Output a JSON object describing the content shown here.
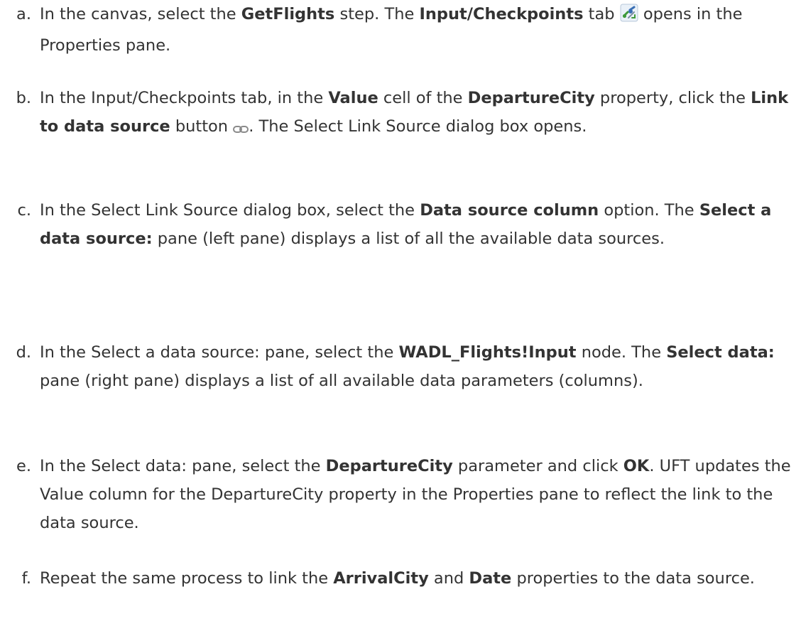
{
  "steps": [
    {
      "letter": "a.",
      "parts": [
        "In the canvas, select the ",
        "GetFlights",
        " step. The ",
        "Input/Checkpoints",
        " tab ",
        " opens in the Properties pane."
      ]
    },
    {
      "letter": "b.",
      "parts": [
        "In the Input/Checkpoints tab, in the ",
        "Value",
        " cell of the ",
        "DepartureCity",
        " property, click the ",
        "Link to data source",
        " button ",
        ". The Select Link Source dialog box opens."
      ]
    },
    {
      "letter": "c.",
      "parts": [
        "In the Select Link Source dialog box, select the ",
        "Data source column",
        " option. The ",
        "Select a data source:",
        " pane (left pane) displays a list of all the available data sources."
      ]
    },
    {
      "letter": "d.",
      "parts": [
        "In the Select a data source: pane, select the ",
        "WADL_Flights!Input",
        " node. The ",
        "Select data:",
        " pane (right pane) displays a list of all available data parameters (columns)."
      ]
    },
    {
      "letter": "e.",
      "parts": [
        "In the Select data: pane, select the ",
        "DepartureCity",
        " parameter and click ",
        "OK",
        ". UFT updates the Value column for the DepartureCity property in the Properties pane to reflect the link to the data source."
      ]
    },
    {
      "letter": "f.",
      "parts": [
        "Repeat the same process to link the ",
        "ArrivalCity",
        " and ",
        "Date",
        " properties to the data source."
      ]
    }
  ],
  "icons": {
    "input_checkpoints_tab": "input-checkpoints-icon",
    "link_to_data_source": "link-icon"
  },
  "colors": {
    "text": "#333333",
    "icon_blue": "#3a6fb5",
    "icon_green": "#3e9a3a"
  }
}
